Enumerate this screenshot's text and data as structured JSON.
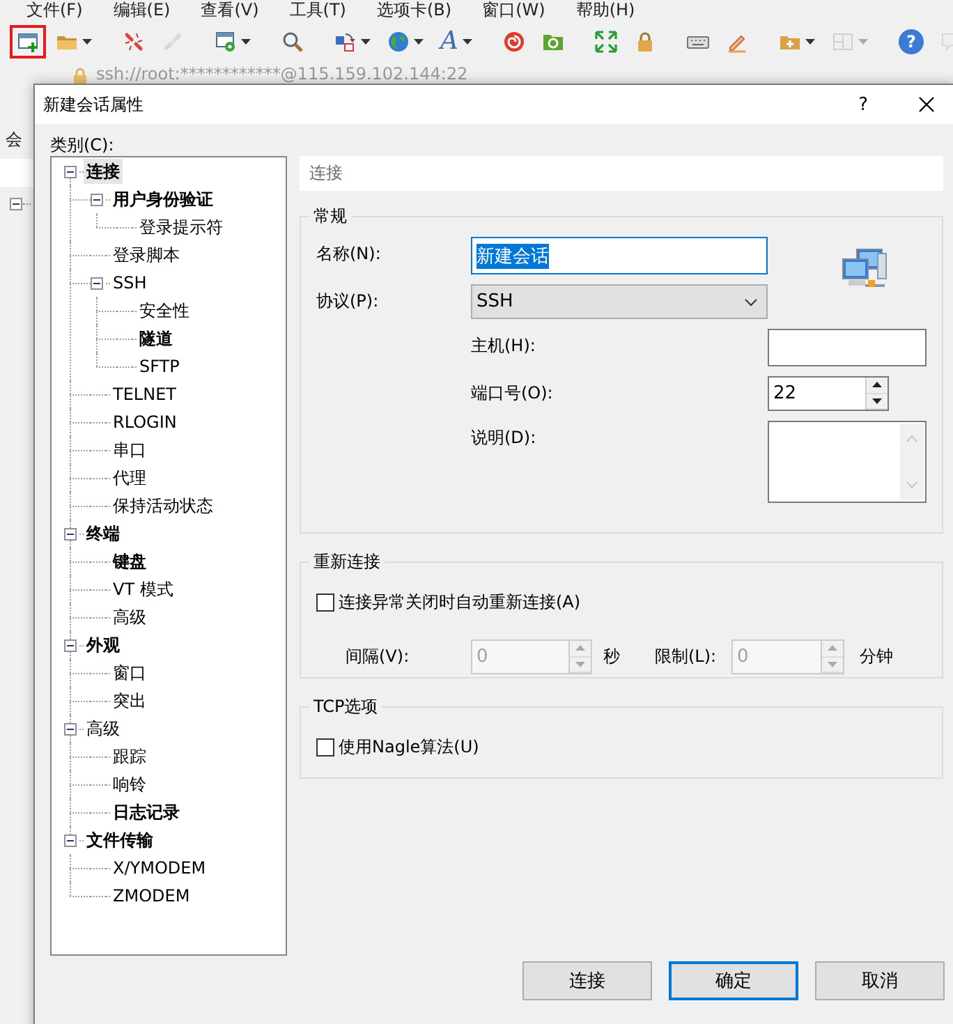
{
  "menu_bar": [
    "文件(F)",
    "编辑(E)",
    "查看(V)",
    "工具(T)",
    "选项卡(B)",
    "窗口(W)",
    "帮助(H)"
  ],
  "toolbar": [
    {
      "kind": "new-session",
      "dropdown": false,
      "disabled": false,
      "highlighted": true
    },
    {
      "kind": "open",
      "dropdown": true,
      "disabled": false,
      "highlighted": false
    },
    {
      "kind": "separator"
    },
    {
      "kind": "disconnect",
      "dropdown": false,
      "disabled": false,
      "highlighted": false
    },
    {
      "kind": "reconnect",
      "dropdown": false,
      "disabled": true,
      "highlighted": false
    },
    {
      "kind": "separator"
    },
    {
      "kind": "properties",
      "dropdown": true,
      "disabled": false,
      "highlighted": false
    },
    {
      "kind": "separator"
    },
    {
      "kind": "find",
      "dropdown": false,
      "disabled": false,
      "highlighted": false
    },
    {
      "kind": "separator"
    },
    {
      "kind": "transfer",
      "dropdown": true,
      "disabled": false,
      "highlighted": false
    },
    {
      "kind": "globe",
      "dropdown": true,
      "disabled": false,
      "highlighted": false
    },
    {
      "kind": "font",
      "glyph": "A",
      "dropdown": true,
      "disabled": false,
      "highlighted": false
    },
    {
      "kind": "separator"
    },
    {
      "kind": "swirl",
      "dropdown": false,
      "disabled": false,
      "highlighted": false
    },
    {
      "kind": "tab-folder",
      "dropdown": false,
      "disabled": false,
      "highlighted": false
    },
    {
      "kind": "separator"
    },
    {
      "kind": "fullscreen",
      "dropdown": false,
      "disabled": false,
      "highlighted": false
    },
    {
      "kind": "lock",
      "dropdown": false,
      "disabled": false,
      "highlighted": false
    },
    {
      "kind": "separator"
    },
    {
      "kind": "keyboard",
      "dropdown": false,
      "disabled": false,
      "highlighted": false
    },
    {
      "kind": "pencil",
      "dropdown": false,
      "disabled": false,
      "highlighted": false
    },
    {
      "kind": "separator"
    },
    {
      "kind": "folder-plus",
      "dropdown": true,
      "disabled": false,
      "highlighted": false
    },
    {
      "kind": "layout",
      "dropdown": true,
      "disabled": true,
      "highlighted": false
    },
    {
      "kind": "separator"
    },
    {
      "kind": "help",
      "glyph": "?",
      "dropdown": false,
      "disabled": false,
      "highlighted": false
    },
    {
      "kind": "chat",
      "dropdown": false,
      "disabled": true,
      "highlighted": false
    }
  ],
  "address_bar": {
    "value": "ssh://root:************@115.159.102.144:22"
  },
  "side_panel": {
    "tab": "会",
    "tree_root": {
      "expanded": true
    }
  },
  "dialog": {
    "title": "新建会话属性",
    "help": "?",
    "category_label": "类别(C):",
    "tree": [
      {
        "label": "连接",
        "bold": true,
        "selected": true,
        "expanded": true,
        "children": [
          {
            "label": "用户身份验证",
            "bold": true,
            "selected": false,
            "expanded": true,
            "children": [
              {
                "label": "登录提示符",
                "bold": false,
                "selected": false
              }
            ]
          },
          {
            "label": "登录脚本",
            "bold": false,
            "selected": false
          },
          {
            "label": "SSH",
            "bold": false,
            "selected": false,
            "expanded": true,
            "children": [
              {
                "label": "安全性",
                "bold": false,
                "selected": false
              },
              {
                "label": "隧道",
                "bold": true,
                "selected": false
              },
              {
                "label": "SFTP",
                "bold": false,
                "selected": false
              }
            ]
          },
          {
            "label": "TELNET",
            "bold": false,
            "selected": false
          },
          {
            "label": "RLOGIN",
            "bold": false,
            "selected": false
          },
          {
            "label": "串口",
            "bold": false,
            "selected": false
          },
          {
            "label": "代理",
            "bold": false,
            "selected": false
          },
          {
            "label": "保持活动状态",
            "bold": false,
            "selected": false
          }
        ]
      },
      {
        "label": "终端",
        "bold": true,
        "selected": false,
        "expanded": true,
        "children": [
          {
            "label": "键盘",
            "bold": true,
            "selected": false
          },
          {
            "label": "VT 模式",
            "bold": false,
            "selected": false
          },
          {
            "label": "高级",
            "bold": false,
            "selected": false
          }
        ]
      },
      {
        "label": "外观",
        "bold": true,
        "selected": false,
        "expanded": true,
        "children": [
          {
            "label": "窗口",
            "bold": false,
            "selected": false
          },
          {
            "label": "突出",
            "bold": false,
            "selected": false
          }
        ]
      },
      {
        "label": "高级",
        "bold": false,
        "selected": false,
        "expanded": true,
        "children": [
          {
            "label": "跟踪",
            "bold": false,
            "selected": false
          },
          {
            "label": "响铃",
            "bold": false,
            "selected": false
          },
          {
            "label": "日志记录",
            "bold": true,
            "selected": false
          }
        ]
      },
      {
        "label": "文件传输",
        "bold": true,
        "selected": false,
        "expanded": true,
        "children": [
          {
            "label": "X/YMODEM",
            "bold": false,
            "selected": false
          },
          {
            "label": "ZMODEM",
            "bold": false,
            "selected": false
          }
        ]
      }
    ],
    "panel_header": "连接",
    "general": {
      "title": "常规",
      "fields": [
        {
          "kind": "text",
          "label": "名称(N):",
          "value": "新建会话",
          "focused": true
        },
        {
          "kind": "select",
          "label": "协议(P):",
          "value": "SSH"
        },
        {
          "kind": "text",
          "label": "主机(H):",
          "focused": false
        },
        {
          "kind": "spin",
          "label": "端口号(O):",
          "value": "22",
          "disabled": false
        },
        {
          "kind": "textarea",
          "label": "说明(D):"
        }
      ]
    },
    "reconnect": {
      "title": "重新连接",
      "checkbox": {
        "label": "连接异常关闭时自动重新连接(A)",
        "checked": false
      },
      "interval": {
        "label": "间隔(V):",
        "value": "0",
        "unit": "秒",
        "disabled": true
      },
      "limit": {
        "label": "限制(L):",
        "value": "0",
        "unit": "分钟",
        "disabled": true
      }
    },
    "tcp": {
      "title": "TCP选项",
      "checkbox": {
        "label": "使用Nagle算法(U)",
        "checked": false
      }
    },
    "buttons": [
      {
        "label": "连接",
        "default": false
      },
      {
        "label": "确定",
        "default": true
      },
      {
        "label": "取消",
        "default": false
      }
    ]
  }
}
